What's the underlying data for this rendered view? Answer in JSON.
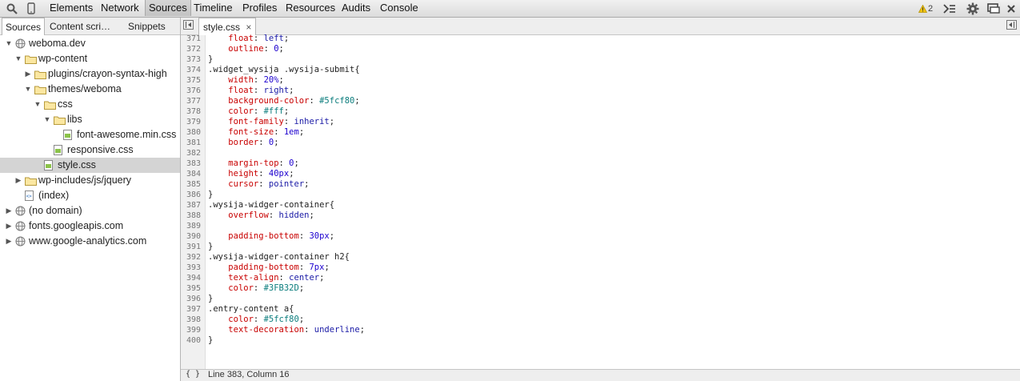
{
  "toolbar": {
    "tabs": [
      "Elements",
      "Network",
      "Sources",
      "Timeline",
      "Profiles",
      "Resources",
      "Audits",
      "Console"
    ],
    "warning_count": "2"
  },
  "navigator": {
    "tabs": [
      "Sources",
      "Content scri…",
      "Snippets"
    ],
    "tree": [
      {
        "label": "weboma.dev",
        "level": 0,
        "expand": "open",
        "icon": "globe-icon"
      },
      {
        "label": "wp-content",
        "level": 1,
        "expand": "open",
        "icon": "folder-icon"
      },
      {
        "label": "plugins/crayon-syntax-high",
        "level": 2,
        "expand": "closed",
        "icon": "folder-icon"
      },
      {
        "label": "themes/weboma",
        "level": 2,
        "expand": "open",
        "icon": "folder-icon"
      },
      {
        "label": "css",
        "level": 3,
        "expand": "open",
        "icon": "folder-icon"
      },
      {
        "label": "libs",
        "level": 4,
        "expand": "open",
        "icon": "folder-icon"
      },
      {
        "label": "font-awesome.min.css",
        "level": 5,
        "expand": "none",
        "icon": "css-file-icon"
      },
      {
        "label": "responsive.css",
        "level": 4,
        "expand": "none",
        "icon": "css-file-icon"
      },
      {
        "label": "style.css",
        "level": 3,
        "expand": "none",
        "icon": "css-file-icon",
        "selected": true
      },
      {
        "label": "wp-includes/js/jquery",
        "level": 1,
        "expand": "closed",
        "icon": "folder-icon"
      },
      {
        "label": "(index)",
        "level": 1,
        "expand": "none",
        "icon": "html-file-icon"
      },
      {
        "label": "(no domain)",
        "level": 0,
        "expand": "closed",
        "icon": "globe-icon"
      },
      {
        "label": "fonts.googleapis.com",
        "level": 0,
        "expand": "closed",
        "icon": "globe-icon"
      },
      {
        "label": "www.google-analytics.com",
        "level": 0,
        "expand": "closed",
        "icon": "globe-icon"
      }
    ]
  },
  "editor": {
    "tab_label": "style.css",
    "first_line": 371,
    "lines": [
      "    float: left;",
      "    outline: 0;",
      "}",
      ".widget_wysija .wysija-submit{",
      "    width: 20%;",
      "    float: right;",
      "    background-color: #5fcf80;",
      "    color: #fff;",
      "    font-family: inherit;",
      "    font-size: 1em;",
      "    border: 0;",
      "",
      "    margin-top: 0;",
      "    height: 40px;",
      "    cursor: pointer;",
      "}",
      ".wysija-widger-container{",
      "    overflow: hidden;",
      "",
      "    padding-bottom: 30px;",
      "}",
      ".wysija-widger-container h2{",
      "    padding-bottom: 7px;",
      "    text-align: center;",
      "    color: #3FB32D;",
      "}",
      ".entry-content a{",
      "    color: #5fcf80;",
      "    text-decoration: underline;",
      "}"
    ],
    "status": "Line 383, Column 16",
    "status_brace": "{ }"
  }
}
